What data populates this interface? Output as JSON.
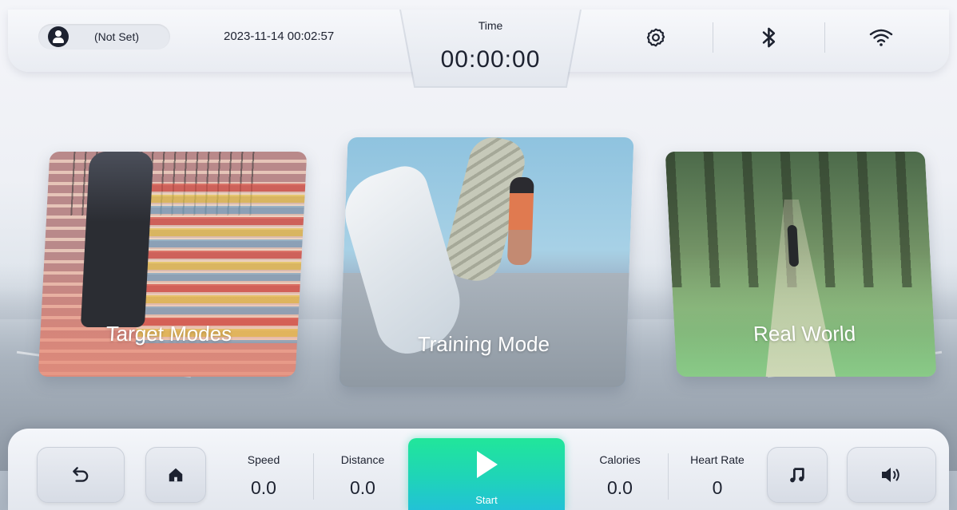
{
  "header": {
    "user_name": "(Not Set)",
    "datetime": "2023-11-14 00:02:57",
    "time_label": "Time",
    "time_value": "00:00:00",
    "icons": [
      "settings-icon",
      "bluetooth-icon",
      "wifi-icon"
    ]
  },
  "modes": [
    {
      "label": "Target Modes",
      "accent": "#e88a74"
    },
    {
      "label": "Training Mode",
      "accent": "#6fb0e0"
    },
    {
      "label": "Real World",
      "accent": "#8ccf87"
    }
  ],
  "footer": {
    "stats": {
      "speed": {
        "label": "Speed",
        "value": "0.0"
      },
      "distance": {
        "label": "Distance",
        "value": "0.0"
      },
      "calories": {
        "label": "Calories",
        "value": "0.0"
      },
      "heart_rate": {
        "label": "Heart Rate",
        "value": "0"
      }
    },
    "start_label": "Start",
    "start_colors": [
      "#21e69a",
      "#22c2d6"
    ],
    "buttons": [
      "back-icon",
      "home-icon",
      "music-icon",
      "volume-icon"
    ]
  }
}
